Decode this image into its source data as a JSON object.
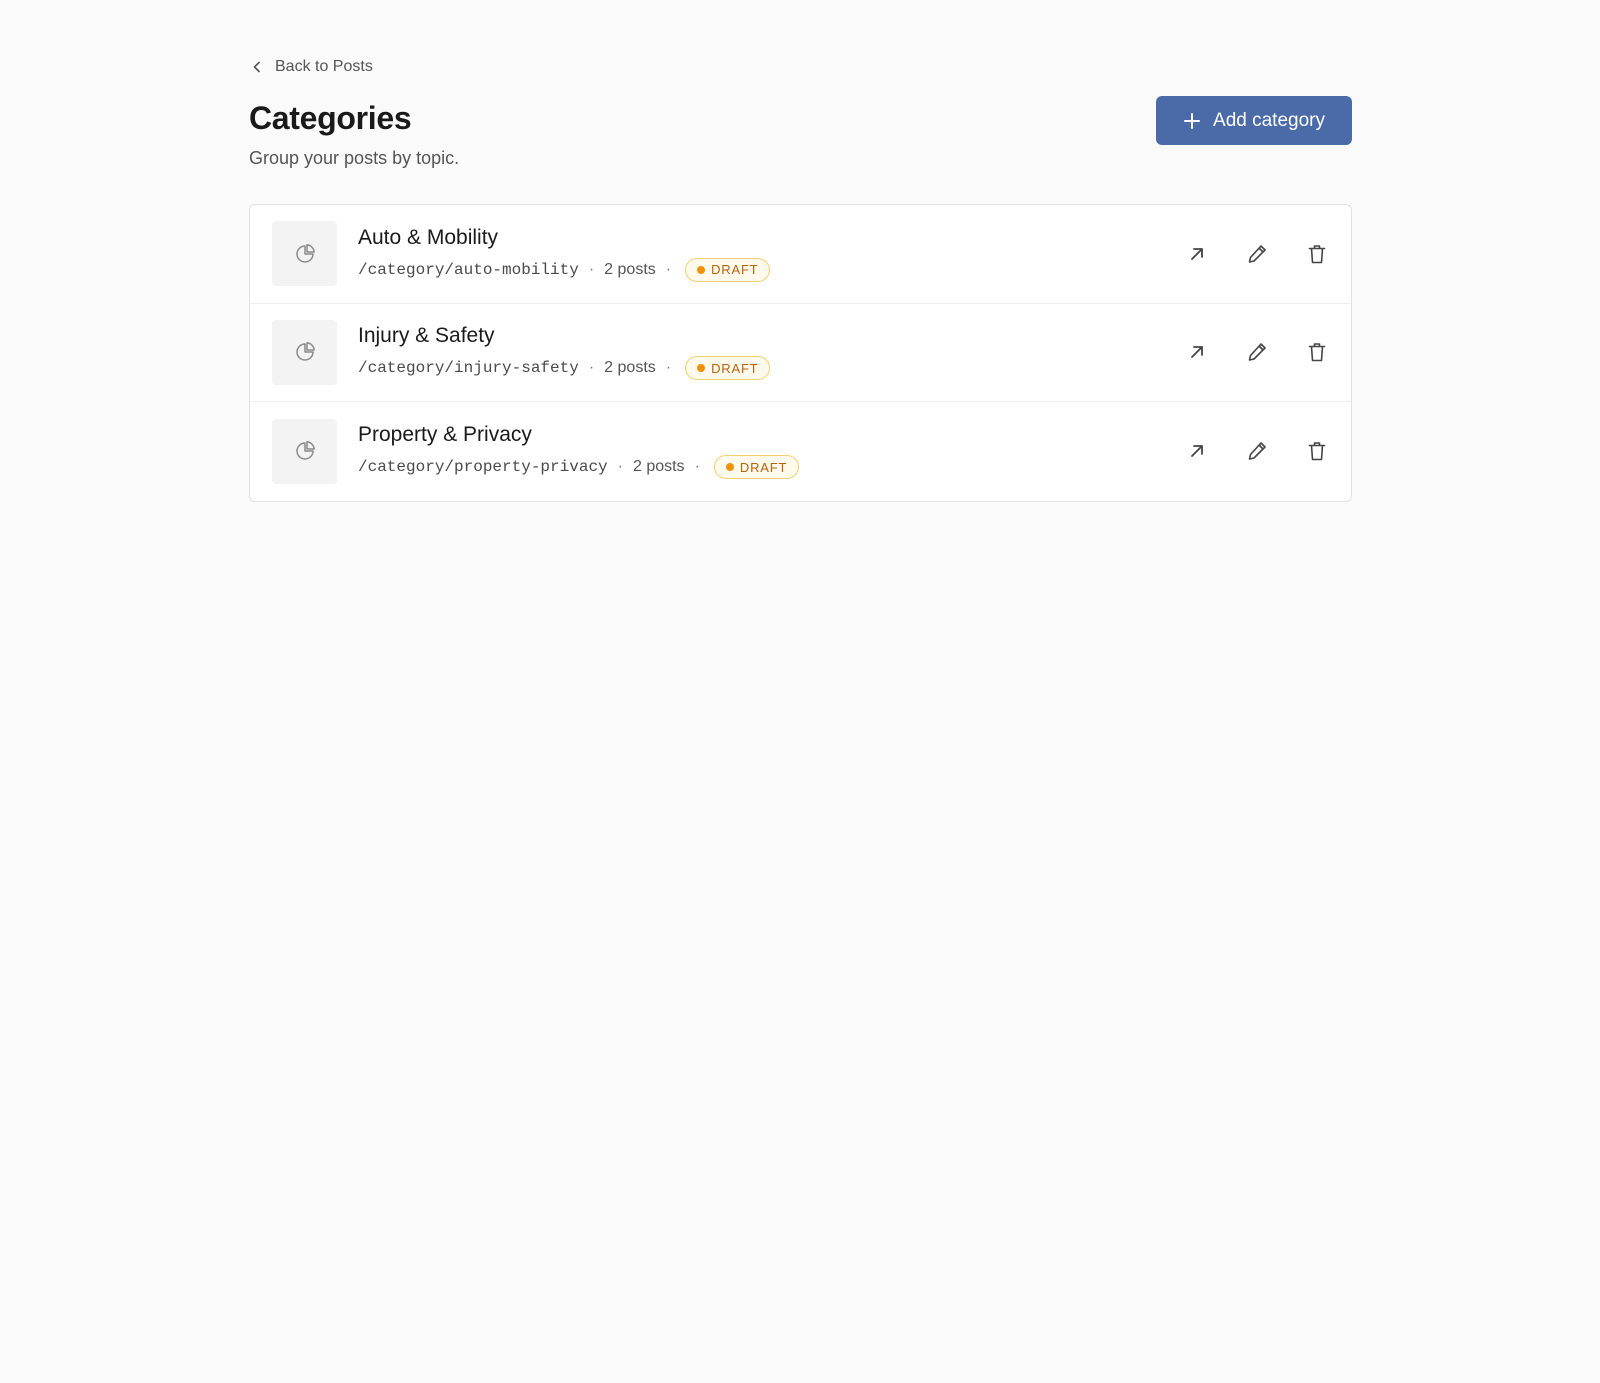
{
  "header": {
    "back_label": "Back to Posts",
    "title": "Categories",
    "subtitle": "Group your posts by topic.",
    "add_label": "Add category"
  },
  "categories": [
    {
      "name": "Auto & Mobility",
      "slug": "/category/auto-mobility",
      "posts": "2 posts",
      "status": "DRAFT"
    },
    {
      "name": "Injury & Safety",
      "slug": "/category/injury-safety",
      "posts": "2 posts",
      "status": "DRAFT"
    },
    {
      "name": "Property & Privacy",
      "slug": "/category/property-privacy",
      "posts": "2 posts",
      "status": "DRAFT"
    }
  ],
  "colors": {
    "accent": "#4a6aa8",
    "draft_text": "#b7620c",
    "draft_dot": "#f0900b",
    "draft_border": "#f2cf72"
  },
  "icons": {
    "back": "chevron-left-icon",
    "add": "plus-icon",
    "thumb": "pie-chart-icon",
    "open": "arrow-up-right-icon",
    "edit": "pencil-icon",
    "delete": "trash-icon"
  }
}
